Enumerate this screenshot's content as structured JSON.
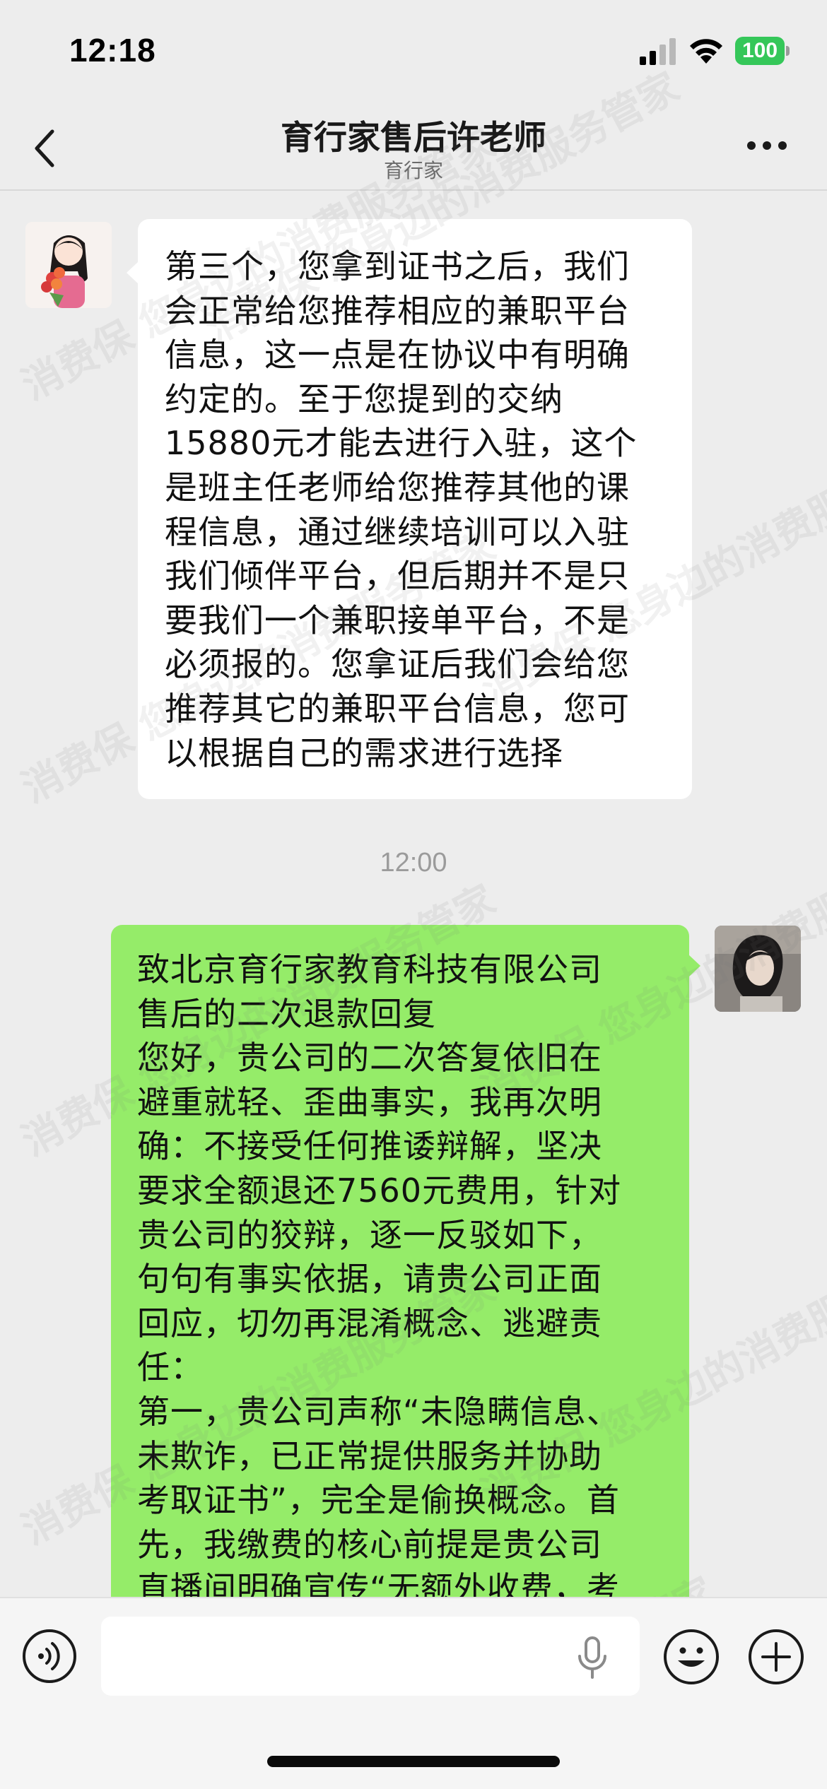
{
  "status_bar": {
    "time": "12:18",
    "battery": "100"
  },
  "nav": {
    "title": "育行家售后许老师",
    "subtitle": "育行家"
  },
  "messages": {
    "incoming": {
      "lines": [
        "第三个，您拿到证书之后，我们",
        "会正常给您推荐相应的兼职平台",
        "信息，这一点是在协议中有明确",
        "约定的。至于您提到的交纳",
        "15880元才能去进行入驻，这个",
        "是班主任老师给您推荐其他的课",
        "程信息，通过继续培训可以入驻",
        "我们倾伴平台，但后期并不是只",
        "要我们一个兼职接单平台，不是",
        "必须报的。您拿证后我们会给您",
        "推荐其它的兼职平台信息，您可",
        "以根据自己的需求进行选择"
      ]
    },
    "timestamp": "12:00",
    "outgoing": {
      "lines": [
        "致北京育行家教育科技有限公司",
        "售后的二次退款回复",
        "您好，贵公司的二次答复依旧在",
        "避重就轻、歪曲事实，我再次明",
        "确：不接受任何推诿辩解，坚决",
        "要求全额退还7560元费用，针对",
        "贵公司的狡辩，逐一反驳如下，",
        "句句有事实依据，请贵公司正面",
        "回应，切勿再混淆概念、逃避责",
        "任：",
        "第一，贵公司声称“未隐瞒信息、",
        "未欺诈，已正常提供服务并协助",
        "考取证书”，完全是偷换概念。首",
        "先，我缴费的核心前提是贵公司",
        "直播间明确宣传“无额外收费，考"
      ]
    }
  },
  "watermark": "消费保 您身边的消费服务管家",
  "input": {
    "placeholder": ""
  },
  "icons": {
    "back": "chevron-left-icon",
    "more": "more-dots-icon",
    "voice": "voice-icon",
    "mic": "microphone-icon",
    "emoji": "emoji-icon",
    "plus": "plus-icon"
  },
  "colors": {
    "background": "#ededed",
    "outgoing_bubble": "#95ec69",
    "incoming_bubble": "#ffffff",
    "battery": "#35c759"
  }
}
